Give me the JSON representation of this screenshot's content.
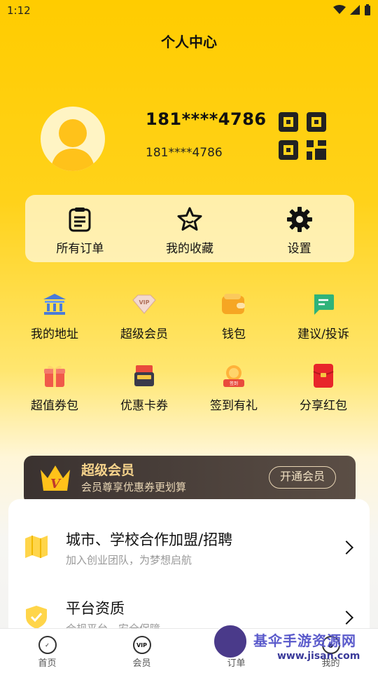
{
  "status": {
    "time": "1:12"
  },
  "title": "个人中心",
  "profile": {
    "name": "181****4786",
    "sub": "181****4786"
  },
  "quick": [
    {
      "icon": "orders-icon",
      "label": "所有订单"
    },
    {
      "icon": "star-icon",
      "label": "我的收藏"
    },
    {
      "icon": "gear-icon",
      "label": "设置"
    }
  ],
  "grid_row1": [
    {
      "icon": "address-icon",
      "label": "我的地址"
    },
    {
      "icon": "vip-icon",
      "label": "超级会员"
    },
    {
      "icon": "wallet-icon",
      "label": "钱包"
    },
    {
      "icon": "feedback-icon",
      "label": "建议/投诉"
    }
  ],
  "grid_row2": [
    {
      "icon": "gift-coupon-icon",
      "label": "超值券包"
    },
    {
      "icon": "card-coupon-icon",
      "label": "优惠卡券"
    },
    {
      "icon": "checkin-icon",
      "label": "签到有礼"
    },
    {
      "icon": "red-packet-icon",
      "label": "分享红包"
    }
  ],
  "vip": {
    "title": "超级会员",
    "sub": "会员尊享优惠券更划算",
    "button": "开通会员"
  },
  "list": [
    {
      "icon": "map-icon",
      "title": "城市、学校合作加盟/招聘",
      "sub": "加入创业团队，为梦想启航"
    },
    {
      "icon": "shield-icon",
      "title": "平台资质",
      "sub": "合规平台，安全保障"
    }
  ],
  "tabs": [
    {
      "icon": "home-icon",
      "label": "首页"
    },
    {
      "icon": "vip-tab-icon",
      "label": "会员"
    },
    {
      "icon": "order-tab-icon",
      "label": "订单"
    },
    {
      "icon": "me-tab-icon",
      "label": "我的"
    }
  ],
  "watermark": {
    "title": "基伞手游资源网",
    "sub": "www.jisan.com"
  },
  "colors": {
    "primary": "#FFCC00",
    "vip_gold": "#F7D48C",
    "dark": "#3a3230"
  }
}
